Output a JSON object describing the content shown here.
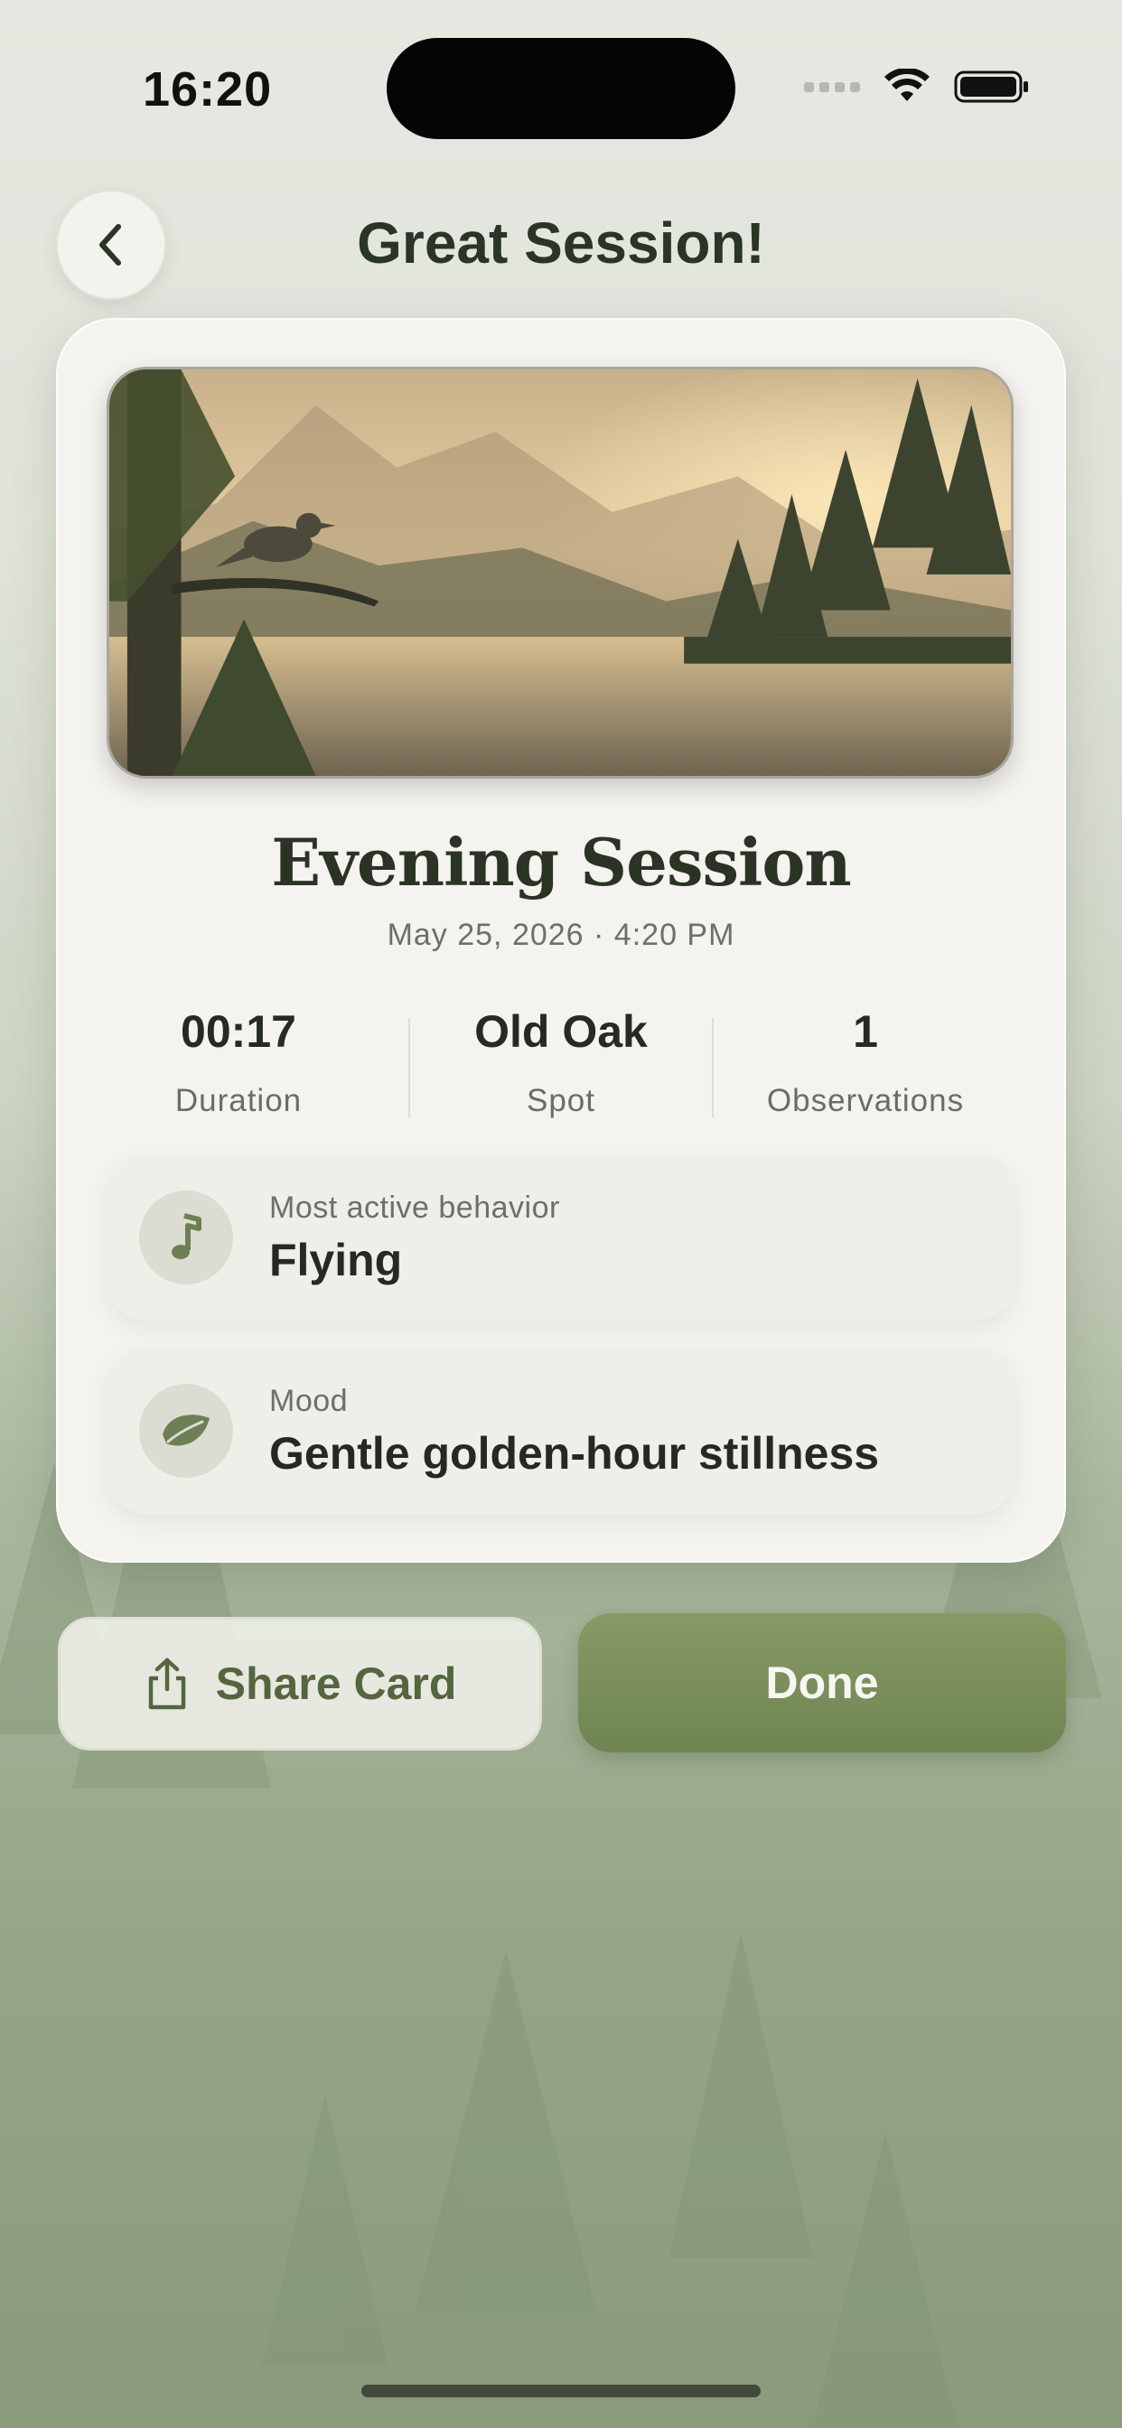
{
  "status_bar": {
    "time": "16:20"
  },
  "header": {
    "title": "Great Session!"
  },
  "session": {
    "title": "Evening Session",
    "date": "May 25, 2026 · 4:20 PM"
  },
  "stats": [
    {
      "value": "00:17",
      "label": "Duration"
    },
    {
      "value": "Old Oak",
      "label": "Spot"
    },
    {
      "value": "1",
      "label": "Observations"
    }
  ],
  "insights": [
    {
      "label": "Most active behavior",
      "value": "Flying",
      "icon": "music-note-icon"
    },
    {
      "label": "Mood",
      "value": "Gentle golden-hour stillness",
      "icon": "leaf-icon"
    }
  ],
  "actions": {
    "share_label": "Share Card",
    "done_label": "Done"
  },
  "colors": {
    "accent": "#7a8f5c",
    "text_dark": "#2b3526",
    "card_bg": "#f4f3ef"
  }
}
